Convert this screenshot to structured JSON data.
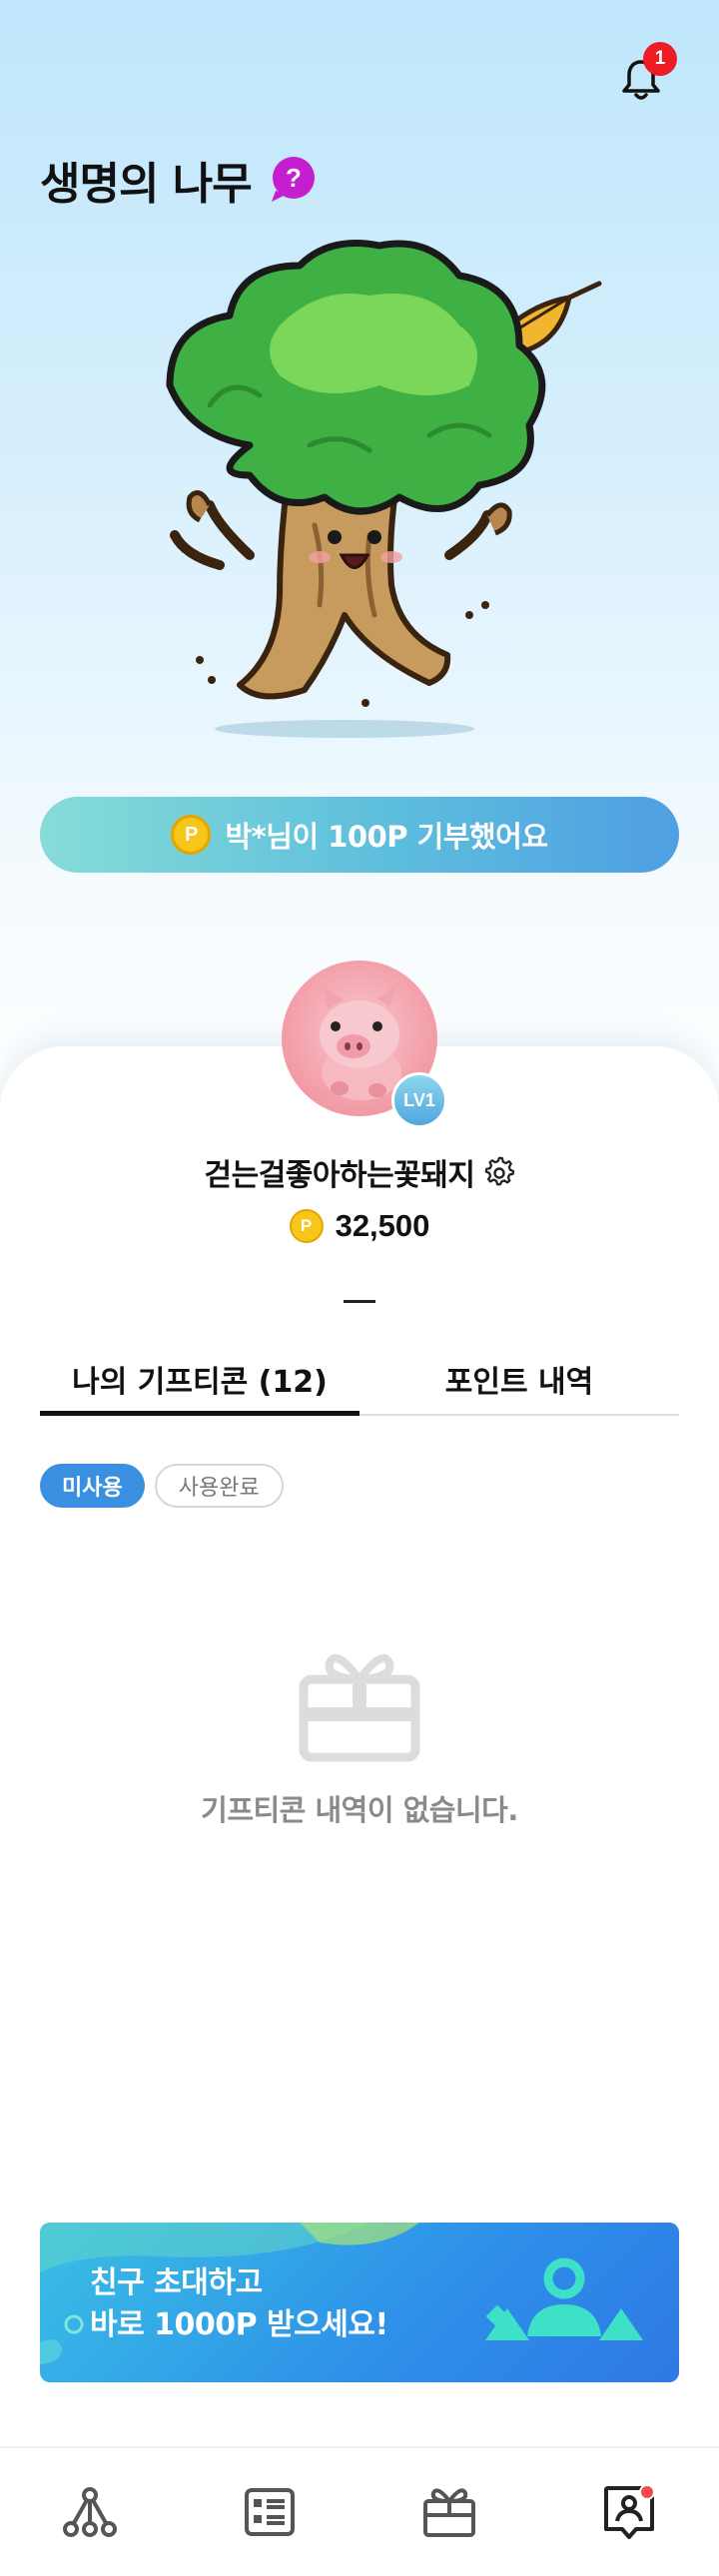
{
  "header": {
    "title": "생명의 나무",
    "notification_count": "1",
    "help_icon": "question-bubble-icon",
    "bell_icon": "bell-icon"
  },
  "donation": {
    "coin_letter": "P",
    "message": "박*님이 100P 기부했어요"
  },
  "profile": {
    "level": "LV1",
    "nickname": "걷는걸좋아하는꽃돼지",
    "points": "32,500",
    "coin_letter": "P"
  },
  "tabs": [
    {
      "label": "나의 기프티콘 (12)",
      "active": true
    },
    {
      "label": "포인트 내역",
      "active": false
    }
  ],
  "filters": [
    {
      "label": "미사용",
      "active": true
    },
    {
      "label": "사용완료",
      "active": false
    }
  ],
  "empty_state": {
    "icon": "gift-box-icon",
    "message": "기프티콘 내역이 없습니다."
  },
  "invite_banner": {
    "line1": "친구 초대하고",
    "line2": "바로 1000P 받으세요!"
  },
  "bottom_nav": [
    {
      "icon": "network-icon"
    },
    {
      "icon": "list-icon"
    },
    {
      "icon": "gift-icon"
    },
    {
      "icon": "profile-icon",
      "has_badge": true
    }
  ],
  "colors": {
    "accent_blue": "#3b8fe0",
    "badge_red": "#ee1c25",
    "coin_yellow": "#f7c61a",
    "help_magenta": "#c41ed0"
  }
}
